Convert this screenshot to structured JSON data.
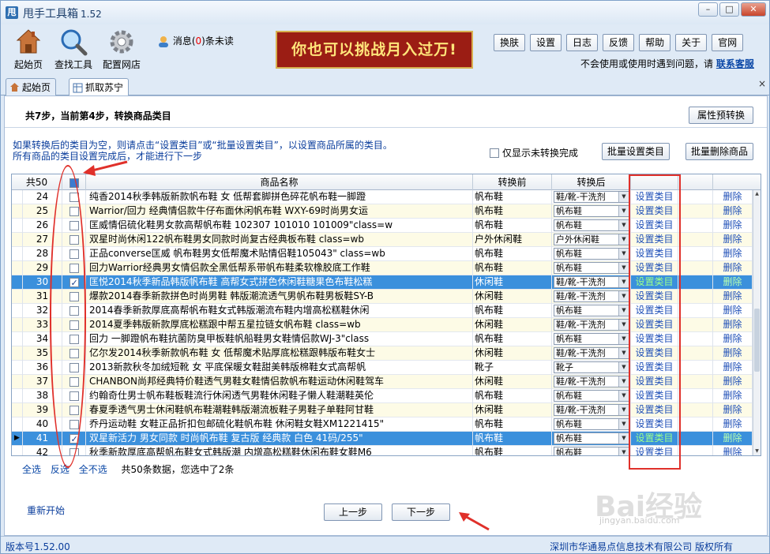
{
  "window": {
    "app_name": "甩手工具箱",
    "version": "1.52",
    "app_icon_text": "甩",
    "min": "–",
    "max": "□",
    "close": "✕"
  },
  "toolbar": {
    "home": "起始页",
    "find": "查找工具",
    "config": "配置网店"
  },
  "message": {
    "prefix": "消息(",
    "count": "0",
    "suffix": ")条未读"
  },
  "banner": "你也可以挑战月入过万!",
  "top_buttons": [
    "换肤",
    "设置",
    "日志",
    "反馈",
    "帮助",
    "关于",
    "官网"
  ],
  "help": {
    "text": "不会使用或使用时遇到问题，请",
    "link": "联系客服"
  },
  "tabs": [
    {
      "label": "起始页",
      "active": false
    },
    {
      "label": "抓取苏宁",
      "active": true
    }
  ],
  "tab_close": "×",
  "step_header": "共7步，当前第4步，转换商品类目",
  "attr_convert_button": "属性预转换",
  "notes": [
    "如果转换后的类目为空，则请点击“设置类目”或“批量设置类目”，以设置商品所属的类目。",
    "所有商品的类目设置完成后，才能进行下一步"
  ],
  "only_unconverted_label": "仅显示未转换完成",
  "batch_set_button": "批量设置类目",
  "batch_delete_button": "批量删除商品",
  "grid": {
    "columns": {
      "count": "共50",
      "name": "商品名称",
      "before": "转换前",
      "after": "转换后"
    },
    "set_label": "设置类目",
    "delete_label": "删除",
    "rows": [
      {
        "num": "24",
        "checked": false,
        "name": "纯香2014秋季韩版新款帆布鞋 女 低帮套脚拼色碎花帆布鞋一脚蹬",
        "before": "帆布鞋",
        "after": "鞋/靴-干洗剂"
      },
      {
        "num": "25",
        "checked": false,
        "name": "Warrior/回力 经典情侣款牛仔布面休闲帆布鞋 WXY-69时尚男女运",
        "before": "帆布鞋",
        "after": "帆布鞋"
      },
      {
        "num": "26",
        "checked": false,
        "name": "匡威情侣硫化鞋男女款高帮帆布鞋 102307 101010 101009\"class=w",
        "before": "帆布鞋",
        "after": "帆布鞋"
      },
      {
        "num": "27",
        "checked": false,
        "name": "双星时尚休闲122帆布鞋男女同款时尚复古经典板布鞋 class=wb",
        "before": "户外休闲鞋",
        "after": "户外休闲鞋"
      },
      {
        "num": "28",
        "checked": false,
        "name": "正品converse匡威 帆布鞋男女低帮魔术贴情侣鞋105043\" class=wb",
        "before": "帆布鞋",
        "after": "帆布鞋"
      },
      {
        "num": "29",
        "checked": false,
        "name": "回力Warrior经典男女情侣款全黑低帮系带帆布鞋柔软橡胶底工作鞋",
        "before": "帆布鞋",
        "after": "帆布鞋"
      },
      {
        "num": "30",
        "checked": true,
        "name": "匡悦2014秋季新品韩版帆布鞋 高帮女式拼色休闲鞋糖果色布鞋松糕",
        "before": "休闲鞋",
        "after": "鞋/靴-干洗剂"
      },
      {
        "num": "31",
        "checked": false,
        "name": "爆款2014春季新款拼色时尚男鞋 韩版潮流透气男帆布鞋男板鞋SY-B",
        "before": "休闲鞋",
        "after": "鞋/靴-干洗剂"
      },
      {
        "num": "32",
        "checked": false,
        "name": "2014春季新款厚底高帮帆布鞋女式韩版潮流布鞋内增高松糕鞋休闲",
        "before": "帆布鞋",
        "after": "帆布鞋"
      },
      {
        "num": "33",
        "checked": false,
        "name": "2014夏季韩版新款厚底松糕跟中帮五星拉链女帆布鞋 class=wb",
        "before": "休闲鞋",
        "after": "鞋/靴-干洗剂"
      },
      {
        "num": "34",
        "checked": false,
        "name": "回力 一脚蹬帆布鞋抗菌防臭甲板鞋帆船鞋男女鞋情侣款WJ-3\"class",
        "before": "帆布鞋",
        "after": "帆布鞋"
      },
      {
        "num": "35",
        "checked": false,
        "name": "亿尔发2014秋季新款帆布鞋 女 低帮魔术贴厚底松糕跟韩版布鞋女士",
        "before": "休闲鞋",
        "after": "鞋/靴-干洗剂"
      },
      {
        "num": "36",
        "checked": false,
        "name": "2013新款秋冬加绒短靴 女 平底保暖女鞋甜美韩版棉鞋女式高帮帆",
        "before": "靴子",
        "after": "靴子"
      },
      {
        "num": "37",
        "checked": false,
        "name": "CHANBON尚邦经典特价鞋透气男鞋女鞋情侣款帆布鞋运动休闲鞋驾车",
        "before": "休闲鞋",
        "after": "鞋/靴-干洗剂"
      },
      {
        "num": "38",
        "checked": false,
        "name": "约翰奇仕男士帆布鞋板鞋流行休闲透气男鞋休闲鞋子懒人鞋潮鞋英伦",
        "before": "帆布鞋",
        "after": "帆布鞋"
      },
      {
        "num": "39",
        "checked": false,
        "name": "春夏季透气男士休闲鞋帆布鞋潮鞋韩版潮流板鞋子男鞋子单鞋阿甘鞋",
        "before": "休闲鞋",
        "after": "鞋/靴-干洗剂"
      },
      {
        "num": "40",
        "checked": false,
        "name": "乔丹运动鞋 女鞋正品折扣包邮硫化鞋帆布鞋 休闲鞋女鞋XM1221415\"",
        "before": "帆布鞋",
        "after": "帆布鞋"
      },
      {
        "num": "41",
        "checked": true,
        "name": "双星新活力 男女同款 时尚帆布鞋 复古版 经典款 白色 41码/255\"",
        "before": "帆布鞋",
        "after": "帆布鞋"
      },
      {
        "num": "42",
        "checked": false,
        "name": "秋季新款厚底高帮帆布鞋女式韩版潮 内增高松糕鞋休闲布鞋女鞋M6",
        "before": "帆布鞋",
        "after": "帆布鞋"
      }
    ]
  },
  "footer": {
    "select_all": "全选",
    "invert": "反选",
    "select_none": "全不选",
    "summary": "共50条数据，您选中了2条"
  },
  "restart_label": "重新开始",
  "prev_button": "上一步",
  "next_button": "下一步",
  "status": {
    "version": "版本号1.52.00",
    "copyright": "深圳市华通易点信息技术有限公司 版权所有"
  },
  "watermark": {
    "text": "Bai经验",
    "sub": "jingyan.baidu.com"
  },
  "colors": {
    "selected_row": "#3b90dc",
    "annotation": "#e0302a",
    "banner_bg": "#9b1d14"
  }
}
